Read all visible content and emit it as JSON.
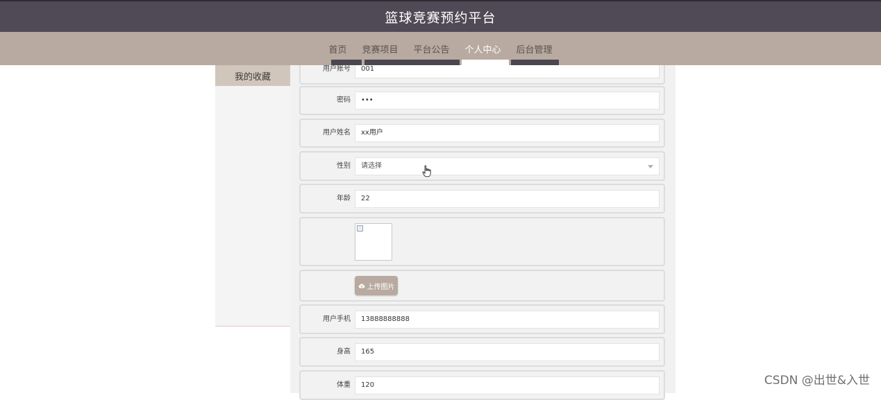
{
  "header": {
    "title": "篮球竞赛预约平台"
  },
  "nav": {
    "items": [
      {
        "label": "首页"
      },
      {
        "label": "竞赛项目"
      },
      {
        "label": "平台公告"
      },
      {
        "label": "个人中心"
      },
      {
        "label": "后台管理"
      }
    ],
    "active": "个人中心"
  },
  "sidebar": {
    "items": [
      {
        "label": "我的收藏"
      }
    ]
  },
  "form": {
    "account": {
      "label": "用户账号",
      "value": "001"
    },
    "password": {
      "label": "密码",
      "value": "•••"
    },
    "name": {
      "label": "用户姓名",
      "value": "xx用户"
    },
    "gender": {
      "label": "性别",
      "value": "请选择"
    },
    "age": {
      "label": "年龄",
      "value": "22"
    },
    "upload": {
      "label": "上传图片"
    },
    "phone": {
      "label": "用户手机",
      "value": "13888888888"
    },
    "height": {
      "label": "身高",
      "value": "165"
    },
    "weight": {
      "label": "体重",
      "value": "120"
    }
  },
  "watermark": "CSDN @出世&入世",
  "colors": {
    "header": "#4f4a56",
    "nav": "#b8aaa0",
    "sidebar_active": "#d1c6bc"
  }
}
